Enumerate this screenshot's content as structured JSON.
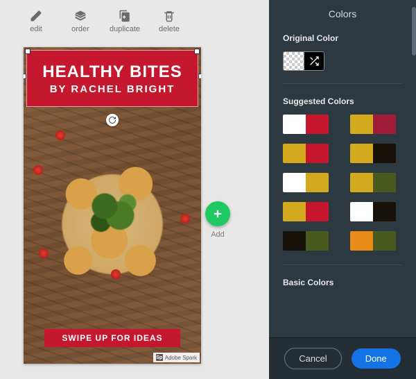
{
  "toolbar": {
    "edit": "edit",
    "order": "order",
    "duplicate": "duplicate",
    "delete": "delete"
  },
  "add_label": "Add",
  "design": {
    "title": "HEALTHY BITES",
    "subtitle": "BY RACHEL BRIGHT",
    "swipe_text": "SWIPE UP FOR IDEAS",
    "watermark_badge": "Sp",
    "watermark_text": "Adobe Spark"
  },
  "panel": {
    "title": "Colors",
    "original_label": "Original Color",
    "suggested_label": "Suggested Colors",
    "basic_label": "Basic Colors",
    "cancel": "Cancel",
    "done": "Done",
    "suggested_pairs": [
      [
        "#ffffff",
        "#c6162e"
      ],
      [
        "#d3a91d",
        "#a01b37"
      ],
      [
        "#d3a91d",
        "#c6162e"
      ],
      [
        "#d3a91d",
        "#161109"
      ],
      [
        "#ffffff",
        "#d3a91d"
      ],
      [
        "#d3a91d",
        "#4a5a1e"
      ],
      [
        "#d3a91d",
        "#c6162e"
      ],
      [
        "#ffffff",
        "#161109"
      ],
      [
        "#161109",
        "#4a5a1e"
      ],
      [
        "#e88b17",
        "#4a5a1e"
      ]
    ]
  }
}
